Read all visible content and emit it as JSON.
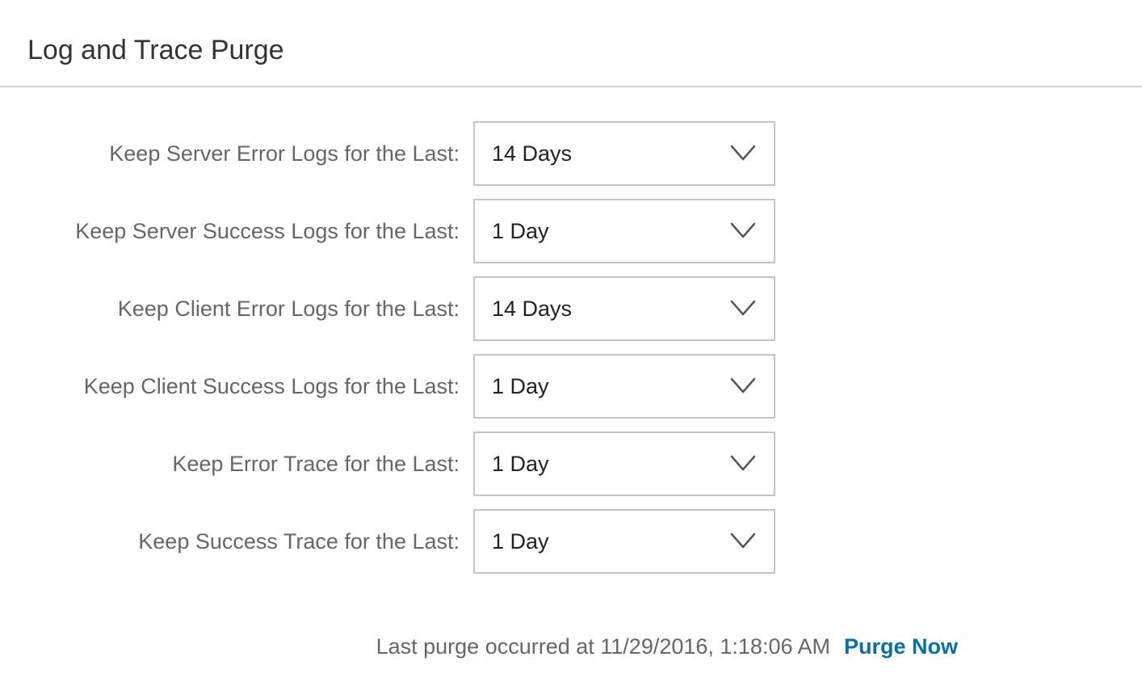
{
  "header": {
    "title": "Log and Trace Purge"
  },
  "settings": [
    {
      "label": "Keep Server Error Logs for the Last:",
      "value": "14 Days",
      "icon": "chevron-down-icon"
    },
    {
      "label": "Keep Server Success Logs for the Last:",
      "value": "1 Day",
      "icon": "chevron-down-icon"
    },
    {
      "label": "Keep Client Error Logs for the Last:",
      "value": "14 Days",
      "icon": "chevron-down-icon"
    },
    {
      "label": "Keep Client Success Logs for the Last:",
      "value": "1 Day",
      "icon": "chevron-down-icon"
    },
    {
      "label": "Keep Error Trace for the Last:",
      "value": "1 Day",
      "icon": "chevron-down-icon"
    },
    {
      "label": "Keep Success Trace for the Last:",
      "value": "1 Day",
      "icon": "chevron-down-icon"
    }
  ],
  "footer": {
    "last_purge_text": "Last purge occurred at 11/29/2016, 1:18:06 AM",
    "purge_now_label": "Purge Now"
  },
  "colors": {
    "link": "#0a6fa8",
    "label_text": "#666666",
    "value_text": "#222222",
    "border": "#c4c4c4"
  }
}
